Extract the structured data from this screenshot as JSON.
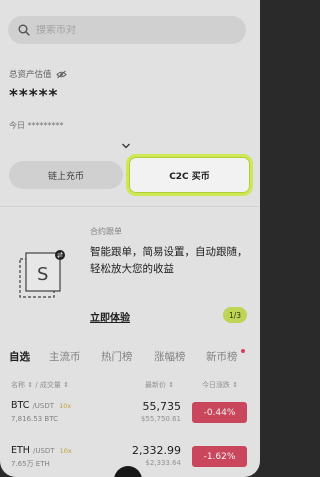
{
  "search": {
    "placeholder": "搜索币对"
  },
  "assets": {
    "label": "总资产估值",
    "value": "*****",
    "today": "今日 *********"
  },
  "buttons": {
    "onchain": "链上充币",
    "c2c": "C2C 买币"
  },
  "promo": {
    "small": "合约跟单",
    "title": "智能跟单，简易设置，自动跟随，轻松放大您的收益",
    "link": "立即体验",
    "page": "1/3"
  },
  "tabs": [
    {
      "label": "自选",
      "active": true
    },
    {
      "label": "主流币",
      "active": false
    },
    {
      "label": "热门榜",
      "active": false
    },
    {
      "label": "涨幅榜",
      "active": false
    },
    {
      "label": "新币榜",
      "active": false
    }
  ],
  "columns": {
    "name": "名称 ⇕ / 成交量 ⇕",
    "price": "最新价 ⇕",
    "change": "今日涨跌 ⇕"
  },
  "rows": [
    {
      "base": "BTC",
      "quote": "/USDT",
      "lev": "10x",
      "volume": "7,816.53 BTC",
      "price": "55,735",
      "price_sub": "$55,750.61",
      "change": "-0.44%"
    },
    {
      "base": "ETH",
      "quote": "/USDT",
      "lev": "10x",
      "volume": "7.65万 ETH",
      "price": "2,332.99",
      "price_sub": "$2,333.64",
      "change": "-1.62%"
    }
  ],
  "colors": {
    "accent": "#d8f45a",
    "down": "#d44a63",
    "badge": "#c9e05a"
  }
}
